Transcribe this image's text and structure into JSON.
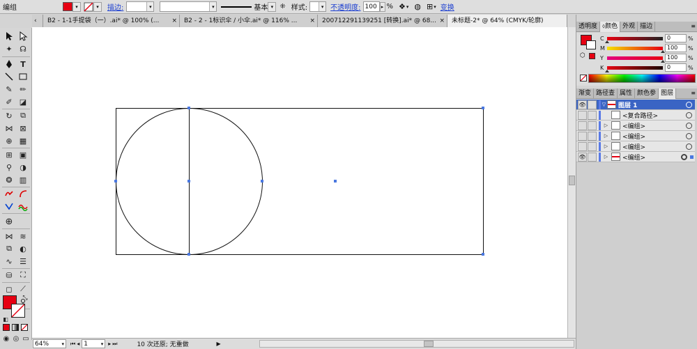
{
  "control_bar": {
    "selection_type": "编组",
    "stroke_label": "描边:",
    "stroke_profile": "基本",
    "style_label": "样式:",
    "opacity_label": "不透明度:",
    "opacity_value": "100",
    "opacity_unit": "%",
    "transform_label": "变换",
    "fill_color": "#e60012"
  },
  "document_tabs": [
    {
      "label": "B2 - 1-1手提袋（一）.ai* @ 100% (...",
      "active": false
    },
    {
      "label": "B2 - 2 - 1标识伞 / 小伞.ai* @ 116% ...",
      "active": false
    },
    {
      "label": "20071229113925​1 [转换].ai* @ 68...",
      "active": false
    },
    {
      "label": "未标题-2* @ 64% (CMYK/轮廓)",
      "active": true
    }
  ],
  "status_bar": {
    "zoom": "64%",
    "artboard": "1",
    "undo_text": "10 次还原; 无重做"
  },
  "color_panel": {
    "tabs": [
      "透明度",
      "颜色",
      "外观",
      "描边"
    ],
    "active_tab": "颜色",
    "channels": [
      {
        "key": "C",
        "value": "0",
        "color": "#00a0e9"
      },
      {
        "key": "M",
        "value": "100",
        "color": "#e4007f"
      },
      {
        "key": "Y",
        "value": "100",
        "color": "#fff100"
      },
      {
        "key": "K",
        "value": "0",
        "color": "#000000"
      }
    ],
    "unit": "%"
  },
  "layers_panel": {
    "tabs": [
      "渐变",
      "路径查",
      "属性",
      "颜色参",
      "图层"
    ],
    "active_tab": "图层",
    "rows": [
      {
        "name": "图层 1",
        "selected": true,
        "visible": true
      },
      {
        "name": "<复合路径>",
        "selected": false,
        "visible": false
      },
      {
        "name": "<编组>",
        "selected": false,
        "visible": false
      },
      {
        "name": "<编组>",
        "selected": false,
        "visible": false
      },
      {
        "name": "<编组>",
        "selected": false,
        "visible": false
      },
      {
        "name": "<编组>",
        "selected": false,
        "visible": true
      }
    ]
  }
}
